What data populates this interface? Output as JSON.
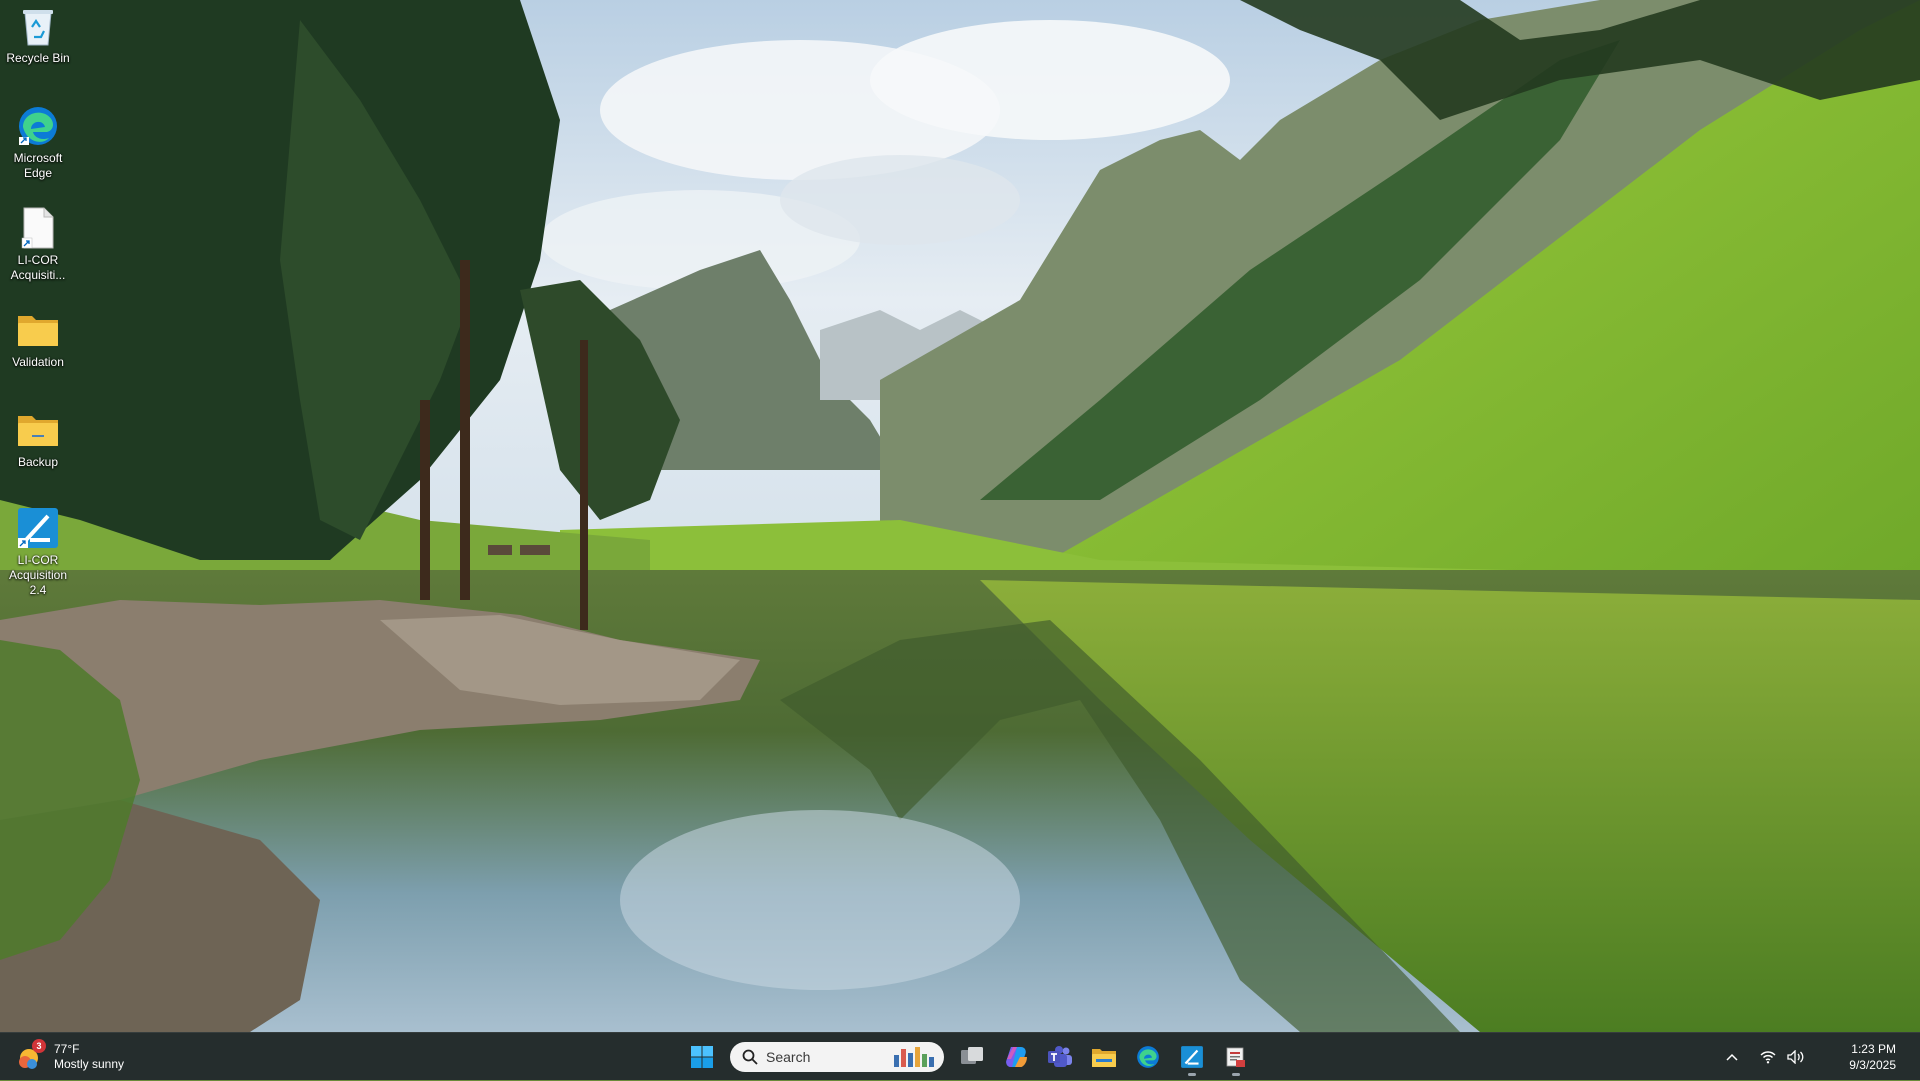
{
  "desktop": {
    "icons": [
      {
        "label": "Recycle Bin",
        "icon": "recycle-bin-icon"
      },
      {
        "label": "Microsoft Edge",
        "icon": "edge-icon"
      },
      {
        "label": "LI-COR Acquisiti...",
        "icon": "document-shortcut-icon"
      },
      {
        "label": "Validation",
        "icon": "folder-icon"
      },
      {
        "label": "Backup",
        "icon": "folder-icon"
      },
      {
        "label": "LI-COR Acquisition 2.4",
        "icon": "licor-acquisition-icon"
      }
    ]
  },
  "taskbar": {
    "weather": {
      "temp": "77°F",
      "condition": "Mostly sunny",
      "badge": "3"
    },
    "search": {
      "placeholder": "Search"
    },
    "apps": [
      {
        "name": "Start",
        "icon": "windows-start-icon"
      },
      {
        "name": "Task View",
        "icon": "task-view-icon"
      },
      {
        "name": "Copilot",
        "icon": "copilot-icon"
      },
      {
        "name": "Teams",
        "icon": "teams-icon"
      },
      {
        "name": "File Explorer",
        "icon": "folder-icon"
      },
      {
        "name": "Microsoft Edge",
        "icon": "edge-icon"
      },
      {
        "name": "LI-COR Acquisition",
        "icon": "licor-acquisition-icon"
      },
      {
        "name": "LI-COR Document",
        "icon": "licor-document-icon"
      }
    ],
    "clock": {
      "time": "1:23 PM",
      "date": "9/3/2025"
    }
  },
  "colors": {
    "taskbar_bg": "#20262c",
    "start_blue": "#4cc2ff",
    "folder_yellow": "#f5c542",
    "licor_blue": "#1a8fd6"
  }
}
